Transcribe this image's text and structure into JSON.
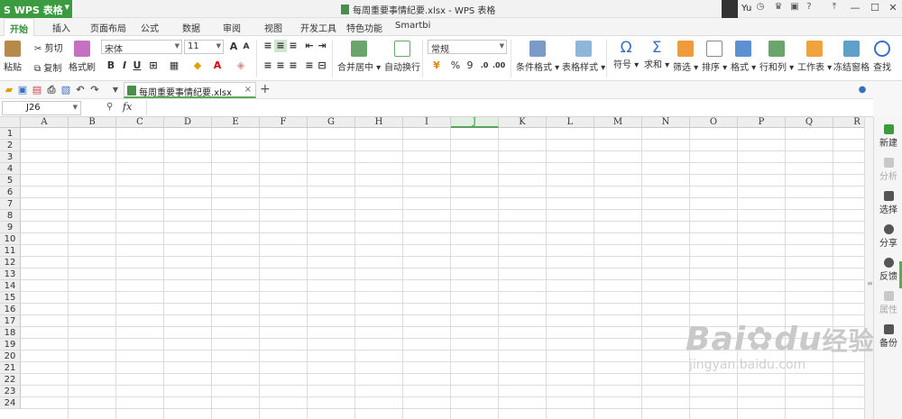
{
  "app": {
    "button_label": "WPS 表格",
    "doc_title": "每周重要事情纪要.xlsx - WPS 表格",
    "user": "Yu"
  },
  "tabs": [
    "开始",
    "插入",
    "页面布局",
    "公式",
    "数据",
    "审阅",
    "视图",
    "开发工具",
    "特色功能",
    "Smartbi"
  ],
  "ribbon": {
    "paste": "粘贴",
    "cut": "剪切",
    "copy": "复制",
    "format_painter": "格式刷",
    "font_name": "宋体",
    "font_size": "11",
    "bold": "B",
    "italic": "I",
    "underline": "U",
    "merge_center": "合并居中",
    "wrap": "自动换行",
    "number_format": "常规",
    "percent": "%",
    "comma": "9",
    "cond_format": "条件格式",
    "table_style": "表格样式",
    "symbol": "符号",
    "sum": "求和",
    "filter": "筛选",
    "sort": "排序",
    "format": "格式",
    "row_col": "行和列",
    "worksheet": "工作表",
    "freeze": "冻结窗格",
    "find": "查找"
  },
  "doc_tab": {
    "name": "每周重要事情纪要.xlsx",
    "close": "×",
    "add": "+"
  },
  "formula_bar": {
    "cell_ref": "J26",
    "fx": "fx"
  },
  "grid": {
    "columns": [
      "A",
      "B",
      "C",
      "D",
      "E",
      "F",
      "G",
      "H",
      "I",
      "J",
      "K",
      "L",
      "M",
      "N",
      "O",
      "P",
      "Q",
      "R"
    ],
    "selected_column": "J",
    "rows": [
      "1",
      "2",
      "3",
      "4",
      "5",
      "6",
      "7",
      "8",
      "9",
      "10",
      "11",
      "12",
      "13",
      "14",
      "15",
      "16",
      "17",
      "18",
      "19",
      "20",
      "21",
      "22",
      "23",
      "24"
    ]
  },
  "right_panel": [
    {
      "label": "新建",
      "disabled": false
    },
    {
      "label": "分析",
      "disabled": true
    },
    {
      "label": "选择",
      "disabled": false
    },
    {
      "label": "分享",
      "disabled": false
    },
    {
      "label": "反馈",
      "disabled": false
    },
    {
      "label": "属性",
      "disabled": true
    },
    {
      "label": "备份",
      "disabled": false
    }
  ],
  "watermark": {
    "brand": "Bai",
    "brand2": "du",
    "suffix": "经验",
    "url": "jingyan.baidu.com"
  },
  "colors": {
    "accent": "#3c9b3f",
    "selection": "#5aa35c"
  }
}
